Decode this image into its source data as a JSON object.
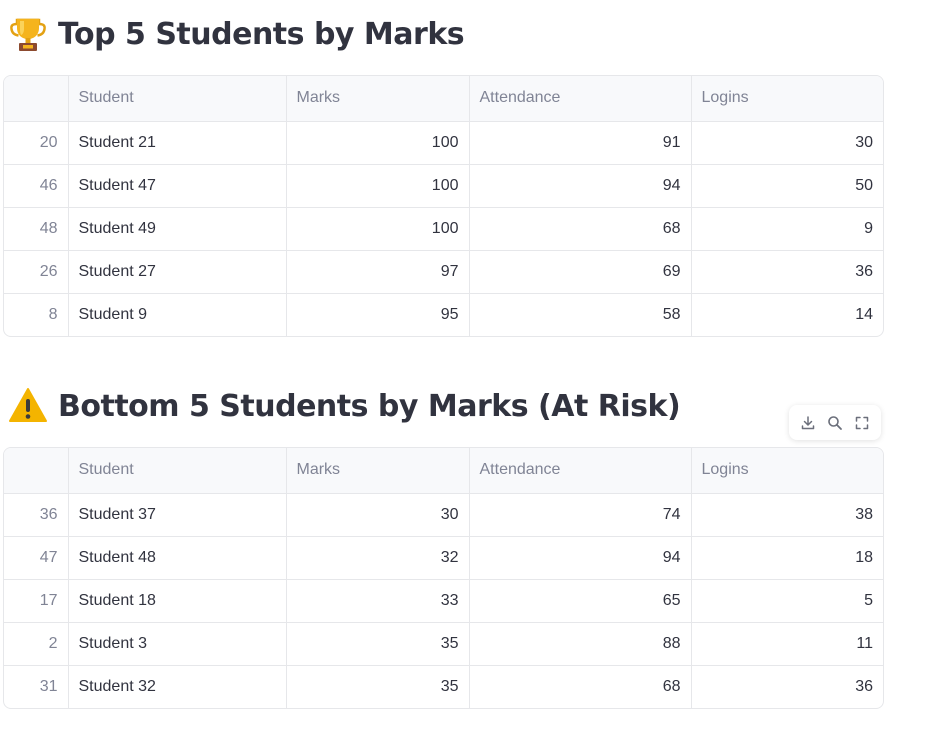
{
  "top_section": {
    "title": "Top 5 Students by Marks",
    "icon": "trophy-icon",
    "columns": [
      "",
      "Student",
      "Marks",
      "Attendance",
      "Logins"
    ],
    "rows": [
      {
        "index": "20",
        "student": "Student 21",
        "marks": "100",
        "attendance": "91",
        "logins": "30"
      },
      {
        "index": "46",
        "student": "Student 47",
        "marks": "100",
        "attendance": "94",
        "logins": "50"
      },
      {
        "index": "48",
        "student": "Student 49",
        "marks": "100",
        "attendance": "68",
        "logins": "9"
      },
      {
        "index": "26",
        "student": "Student 27",
        "marks": "97",
        "attendance": "69",
        "logins": "36"
      },
      {
        "index": "8",
        "student": "Student 9",
        "marks": "95",
        "attendance": "58",
        "logins": "14"
      }
    ]
  },
  "bottom_section": {
    "title": "Bottom 5 Students by Marks (At Risk)",
    "icon": "warning-icon",
    "columns": [
      "",
      "Student",
      "Marks",
      "Attendance",
      "Logins"
    ],
    "rows": [
      {
        "index": "36",
        "student": "Student 37",
        "marks": "30",
        "attendance": "74",
        "logins": "38"
      },
      {
        "index": "47",
        "student": "Student 48",
        "marks": "32",
        "attendance": "94",
        "logins": "18"
      },
      {
        "index": "17",
        "student": "Student 18",
        "marks": "33",
        "attendance": "65",
        "logins": "5"
      },
      {
        "index": "2",
        "student": "Student 3",
        "marks": "35",
        "attendance": "88",
        "logins": "11"
      },
      {
        "index": "31",
        "student": "Student 32",
        "marks": "35",
        "attendance": "68",
        "logins": "36"
      }
    ]
  },
  "toolbar": {
    "buttons": [
      "download-icon",
      "search-icon",
      "fullscreen-icon"
    ]
  },
  "colors": {
    "text": "#31333f",
    "muted_text": "#808495",
    "header_bg": "#f8f9fb",
    "border": "#e6e7ea"
  }
}
